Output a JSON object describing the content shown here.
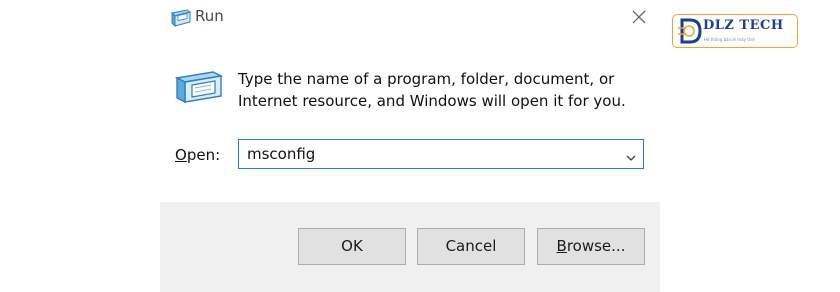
{
  "window": {
    "title": "Run",
    "close_glyph": "✕"
  },
  "description": {
    "line1": "Type the name of a program, folder, document, or",
    "line2": "Internet resource, and Windows will open it for you."
  },
  "open_field": {
    "label_accel": "O",
    "label_rest": "pen:",
    "value": "msconfig"
  },
  "buttons": {
    "ok": "OK",
    "cancel": "Cancel",
    "browse_accel": "B",
    "browse_rest": "rowse..."
  },
  "watermark": {
    "brand": "DLZ TECH",
    "tagline": "Hệ thống bán lẻ máy tính",
    "colors": {
      "text": "#1d3f8c",
      "border": "#f2a23a"
    }
  },
  "icons": [
    "run-icon",
    "close-icon",
    "chevron-down-icon",
    "dlz-logo-icon"
  ],
  "colors": {
    "focus_border": "#2a7bd2",
    "footer_bg": "#f0f0f0",
    "button_bg": "#e1e1e1"
  }
}
